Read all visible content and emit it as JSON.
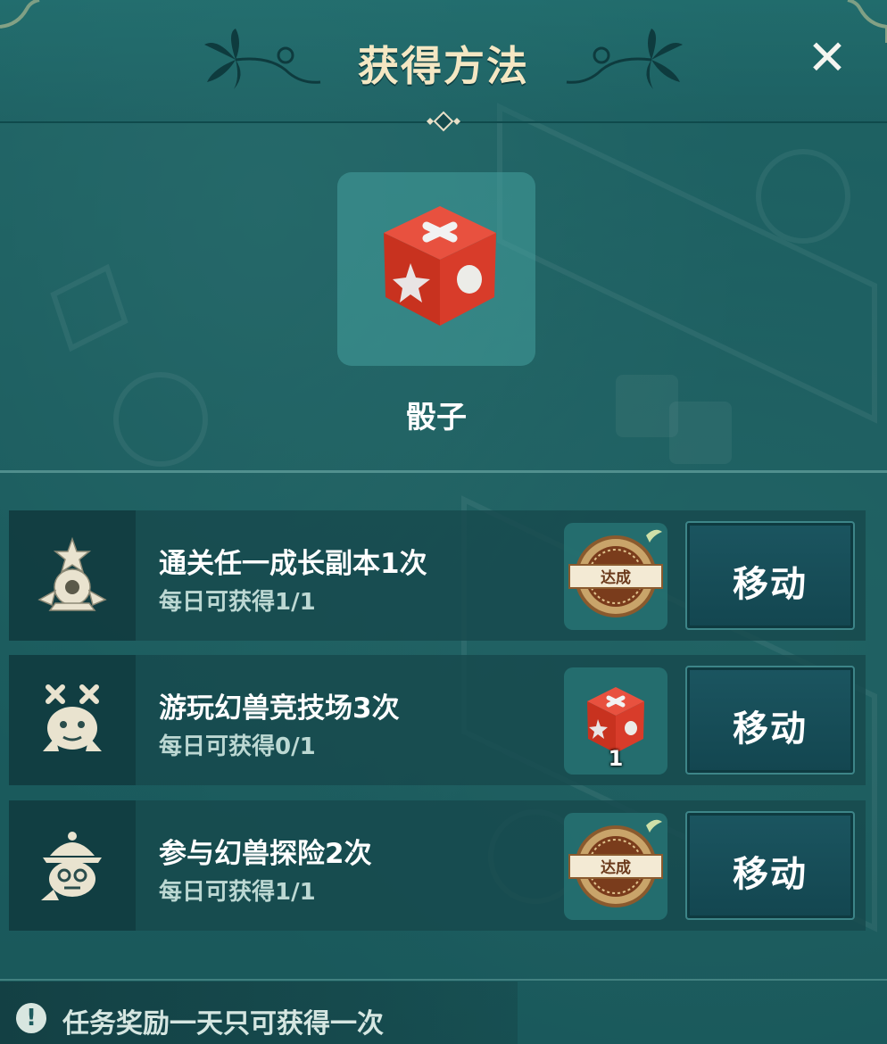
{
  "dialog": {
    "title": "获得方法",
    "close_label": "✕"
  },
  "item": {
    "name": "骰子",
    "icon": "red-dice-icon"
  },
  "tasks": [
    {
      "title": "通关任一成长副本1次",
      "progress": "每日可获得1/1",
      "icon": "dungeon-emblem-icon",
      "reward_icon": "completed-stamp-icon",
      "reward_label": "达成",
      "action_label": "移动"
    },
    {
      "title": "游玩幻兽竞技场3次",
      "progress": "每日可获得0/1",
      "icon": "arena-beast-icon",
      "reward_icon": "red-dice-icon",
      "reward_count": "1",
      "action_label": "移动"
    },
    {
      "title": "参与幻兽探险2次",
      "progress": "每日可获得1/1",
      "icon": "explorer-beast-icon",
      "reward_icon": "completed-stamp-icon",
      "reward_label": "达成",
      "action_label": "移动"
    }
  ],
  "footer": {
    "icon": "exclamation-icon",
    "notice": "任务奖励一天只可获得一次"
  },
  "colors": {
    "title": "#f4e7c3",
    "panel": "#1f6364",
    "button": "#134650",
    "dice_red": "#d93a2b"
  }
}
